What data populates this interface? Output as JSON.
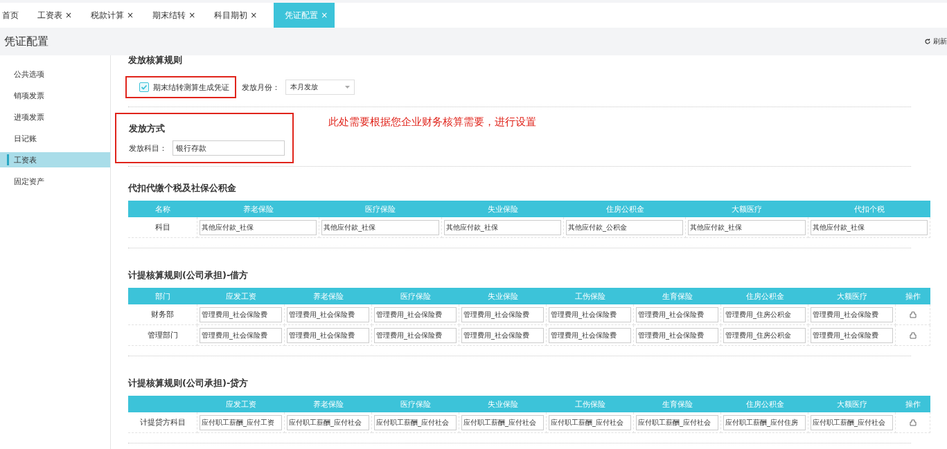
{
  "tabs": [
    {
      "label": "首页",
      "selected": false
    },
    {
      "label": "工资表",
      "close": "×",
      "selected": false
    },
    {
      "label": "税款计算",
      "close": "×",
      "selected": false
    },
    {
      "label": "期末结转",
      "close": "×",
      "selected": false
    },
    {
      "label": "科目期初",
      "close": "×",
      "selected": false
    },
    {
      "label": "凭证配置",
      "close": "×",
      "selected": true
    }
  ],
  "header": {
    "title": "凭证配置",
    "refresh": "刷新"
  },
  "sidebar": {
    "items": [
      {
        "label": "公共选项",
        "selected": false
      },
      {
        "label": "销项发票",
        "selected": false
      },
      {
        "label": "进项发票",
        "selected": false
      },
      {
        "label": "日记账",
        "selected": false
      },
      {
        "label": "工资表",
        "selected": true
      },
      {
        "label": "固定资产",
        "selected": false
      }
    ]
  },
  "payment_rule": {
    "title": "发放核算规则",
    "checkbox": {
      "label": "期末结转测算生成凭证",
      "checked": true,
      "highlighted": true
    },
    "month_label": "发放月份：",
    "month_select": "本月发放"
  },
  "payment_method": {
    "title": "发放方式",
    "highlighted": true,
    "field_label": "发放科目：",
    "field_value": "银行存款",
    "note": "此处需要根据您企业财务核算需要，进行设置"
  },
  "tables": [
    {
      "title": "代扣代缴个税及社保公积金",
      "columns": [
        "名称",
        "养老保险",
        "医疗保险",
        "失业保险",
        "住房公积金",
        "大额医疗",
        "代扣个税"
      ],
      "rows": [
        {
          "label": "科目",
          "values": [
            "其他应付款_社保",
            "其他应付款_社保",
            "其他应付款_社保",
            "其他应付款_公积金",
            "其他应付款_社保",
            "其他应付款_社保"
          ]
        }
      ]
    },
    {
      "title": "计提核算规则(公司承担)-借方",
      "columns": [
        "部门",
        "应发工资",
        "养老保险",
        "医疗保险",
        "失业保险",
        "工伤保险",
        "生育保险",
        "住房公积金",
        "大额医疗",
        "操作"
      ],
      "rows": [
        {
          "label": "财务部",
          "values": [
            "管理费用_社会保险费",
            "管理费用_社会保险费",
            "管理费用_社会保险费",
            "管理费用_社会保险费",
            "管理费用_社会保险费",
            "管理费用_社会保险费",
            "管理费用_住房公积金",
            "管理费用_社会保险费"
          ],
          "action": true
        },
        {
          "label": "管理部门",
          "values": [
            "管理费用_社会保险费",
            "管理费用_社会保险费",
            "管理费用_社会保险费",
            "管理费用_社会保险费",
            "管理费用_社会保险费",
            "管理费用_社会保险费",
            "管理费用_住房公积金",
            "管理费用_社会保险费"
          ],
          "action": true
        }
      ]
    },
    {
      "title": "计提核算规则(公司承担)-贷方",
      "columns": [
        "",
        "应发工资",
        "养老保险",
        "医疗保险",
        "失业保险",
        "工伤保险",
        "生育保险",
        "住房公积金",
        "大额医疗",
        "操作"
      ],
      "rows": [
        {
          "label": "计提贷方科目",
          "values": [
            "应付职工薪酬_应付工资",
            "应付职工薪酬_应付社会",
            "应付职工薪酬_应付社会",
            "应付职工薪酬_应付社会",
            "应付职工薪酬_应付社会",
            "应付职工薪酬_应付社会",
            "应付职工薪酬_应付住房",
            "应付职工薪酬_应付社会"
          ],
          "action": true
        }
      ]
    }
  ]
}
